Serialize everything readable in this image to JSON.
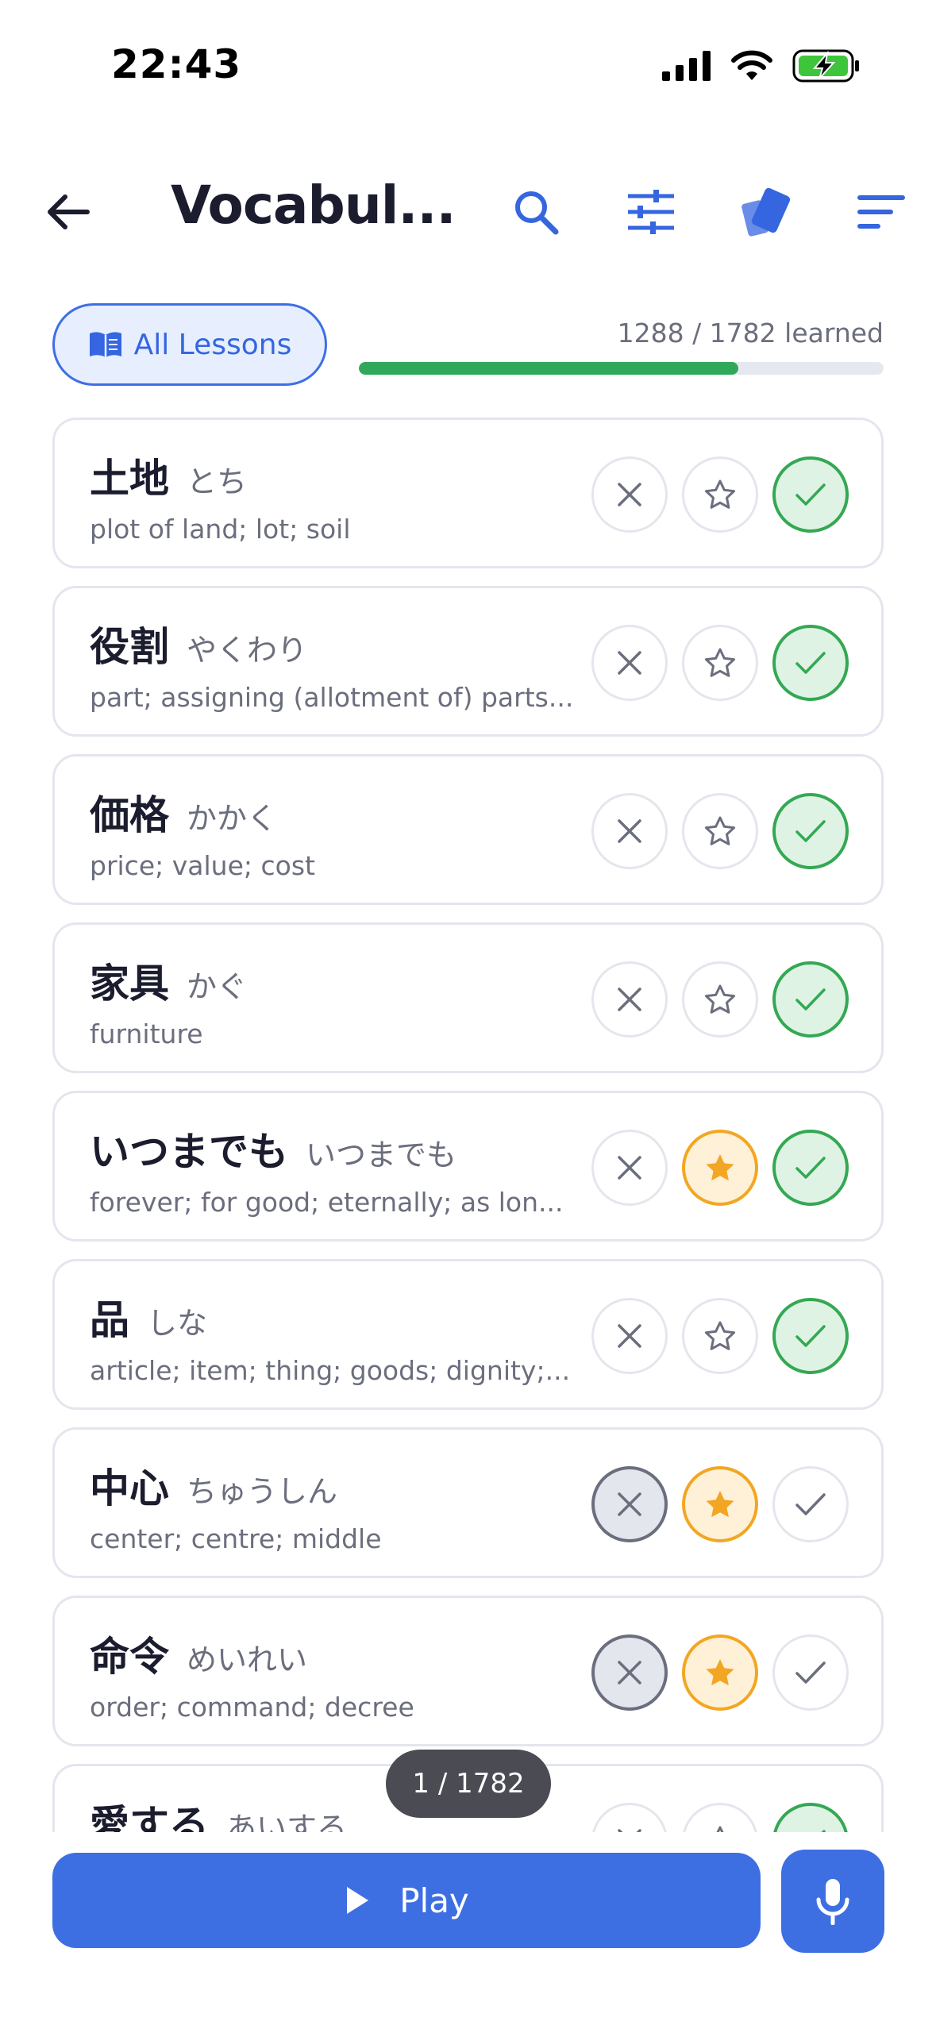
{
  "status_bar": {
    "time": "22:43"
  },
  "header": {
    "title": "Vocabul...",
    "icons": [
      "back-arrow-icon",
      "search-icon",
      "sliders-icon",
      "flashcards-icon",
      "sort-icon"
    ]
  },
  "filter": {
    "lessons_label": "All Lessons"
  },
  "progress": {
    "label": "1288 / 1782 learned",
    "learned": 1288,
    "total": 1782
  },
  "cards": [
    {
      "kanji": "土地",
      "kana": "とち",
      "meaning": "plot of land; lot; soil",
      "x_active": false,
      "star_active": false,
      "check_active": true
    },
    {
      "kanji": "役割",
      "kana": "やくわり",
      "meaning": "part; assigning (allotment of) parts...",
      "x_active": false,
      "star_active": false,
      "check_active": true
    },
    {
      "kanji": "価格",
      "kana": "かかく",
      "meaning": "price; value; cost",
      "x_active": false,
      "star_active": false,
      "check_active": true
    },
    {
      "kanji": "家具",
      "kana": "かぐ",
      "meaning": "furniture",
      "x_active": false,
      "star_active": false,
      "check_active": true
    },
    {
      "kanji": "いつまでも",
      "kana": "いつまでも",
      "meaning": "forever; for good; eternally; as lon...",
      "x_active": false,
      "star_active": true,
      "check_active": true
    },
    {
      "kanji": "品",
      "kana": "しな",
      "meaning": "article; item; thing; goods; dignity;...",
      "x_active": false,
      "star_active": false,
      "check_active": true
    },
    {
      "kanji": "中心",
      "kana": "ちゅうしん",
      "meaning": "center; centre; middle",
      "x_active": true,
      "star_active": true,
      "check_active": false
    },
    {
      "kanji": "命令",
      "kana": "めいれい",
      "meaning": "order; command; decree",
      "x_active": true,
      "star_active": true,
      "check_active": false
    },
    {
      "kanji": "愛する",
      "kana": "あいする",
      "meaning": "",
      "x_active": false,
      "star_active": false,
      "check_active": true
    }
  ],
  "counter": "1 / 1782",
  "bottom": {
    "play_label": "Play"
  },
  "colors": {
    "accent": "#3d6fe3",
    "learned_green": "#34a853",
    "star_orange": "#f3a623"
  }
}
